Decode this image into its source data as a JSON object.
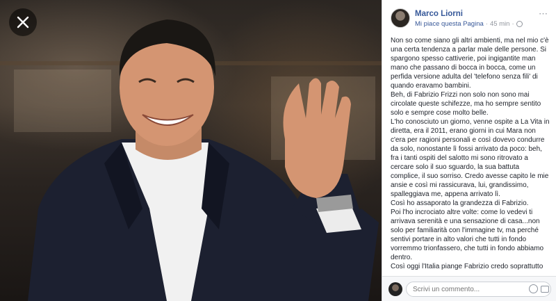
{
  "viewer": {
    "close_icon": "close-icon",
    "photo_alt": "Smiling man in a dark suit waving his hand"
  },
  "post": {
    "author": "Marco Liorni",
    "like_page": "Mi piace questa Pagina",
    "separator": "·",
    "time": "45 min",
    "separator2": "·",
    "privacy_icon": "globe-icon",
    "paragraphs": [
      "Non so come siano gli altri ambienti, ma nel mio c'è una certa tendenza a parlar male delle persone. Si spargono spesso cattiverie, poi ingigantite man mano che passano di bocca in bocca, come un perfida versione adulta del 'telefono senza fili' di quando eravamo bambini.",
      "Beh, di Fabrizio Frizzi non solo non sono mai circolate queste schifezze, ma ho sempre sentito solo e sempre cose molto belle.",
      "L'ho conosciuto un giorno, venne ospite a La Vita in diretta, era il 2011, erano giorni in cui Mara non c'era per ragioni personali e così dovevo condurre da solo, nonostante lì fossi arrivato da poco: beh, fra i tanti ospiti del salotto mi sono ritrovato a cercare solo il suo sguardo, la sua battuta complice, il suo sorriso. Credo avesse capito le mie ansie e così mi rassicurava, lui, grandissimo, spalleggiava me, appena arrivato lì.",
      "Così ho assaporato la grandezza di Fabrizio.",
      "Poi l'ho incrociato altre volte: come lo vedevi ti arrivava serenità e una sensazione di casa...non solo per familiarità con l'immagine tv, ma perché sentivi portare in alto valori che tutti in fondo vorremmo trionfassero, che tutti in fondo abbiamo dentro.",
      "Così oggi l'Italia piange Fabrizio credo soprattutto per questo...perché non ha mai tradito quello che tutti sentiamo giusto."
    ]
  },
  "comment": {
    "placeholder": "Scrivi un commento...",
    "emoji_icon": "emoji-icon",
    "camera_icon": "camera-icon"
  },
  "colors": {
    "link": "#365899",
    "meta": "#90949c",
    "text": "#1d2129",
    "panel_bg": "#ffffff",
    "comment_bg": "#f6f7f9"
  }
}
